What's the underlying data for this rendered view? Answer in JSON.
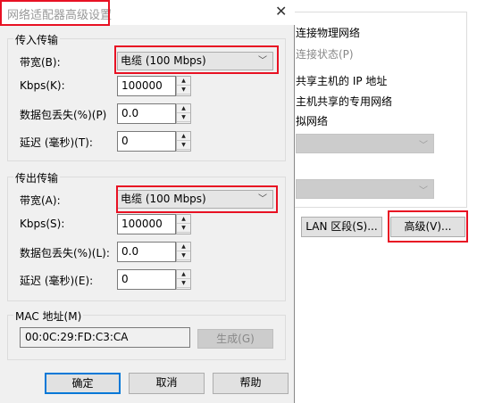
{
  "background": {
    "lines": [
      "连接物理网络",
      "连接状态(P)",
      "共享主机的 IP 地址",
      "主机共享的专用网络",
      "拟网络"
    ],
    "lan_button": "LAN 区段(S)...",
    "advanced_button": "高级(V)..."
  },
  "dialog": {
    "title": "网络适配器高级设置",
    "incoming": {
      "legend": "传入传输",
      "bandwidth_label": "带宽(B):",
      "bandwidth_value": "电缆 (100 Mbps)",
      "kbps_label": "Kbps(K):",
      "kbps_value": "100000",
      "loss_label": "数据包丢失(%)(P)",
      "loss_value": "0.0",
      "delay_label": "延迟 (毫秒)(T):",
      "delay_value": "0"
    },
    "outgoing": {
      "legend": "传出传输",
      "bandwidth_label": "带宽(A):",
      "bandwidth_value": "电缆 (100 Mbps)",
      "kbps_label": "Kbps(S):",
      "kbps_value": "100000",
      "loss_label": "数据包丢失(%)(L):",
      "loss_value": "0.0",
      "delay_label": "延迟 (毫秒)(E):",
      "delay_value": "0"
    },
    "mac": {
      "legend": "MAC 地址(M)",
      "value": "00:0C:29:FD:C3:CA",
      "generate": "生成(G)"
    },
    "ok": "确定",
    "cancel": "取消",
    "help": "帮助"
  },
  "colors": {
    "highlight": "#e81123",
    "focus": "#0078d7"
  }
}
